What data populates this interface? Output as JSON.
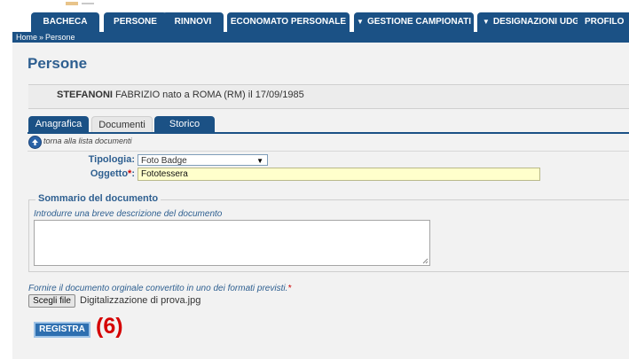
{
  "nav": {
    "tabs": [
      {
        "label": "BACHECA",
        "has_dropdown": false
      },
      {
        "label": "PERSONE",
        "has_dropdown": false
      },
      {
        "label": "RINNOVI",
        "has_dropdown": false
      },
      {
        "label": "ECONOMATO PERSONALE",
        "has_dropdown": false
      },
      {
        "label": "GESTIONE CAMPIONATI",
        "has_dropdown": true
      },
      {
        "label": "DESIGNAZIONI UDG",
        "has_dropdown": true
      },
      {
        "label": "PROFILO",
        "has_dropdown": false
      }
    ],
    "dropdown_glyph": "▼"
  },
  "breadcrumb": {
    "home": "Home",
    "separator": "»",
    "current": "Persone"
  },
  "page": {
    "title": "Persone"
  },
  "person": {
    "surname_name": "STEFANONI",
    "first_name_and_rest": " FABRIZIO nato a ROMA (RM) il 17/09/1985"
  },
  "subtabs": [
    {
      "label": "Anagrafica",
      "active": false
    },
    {
      "label": "Documenti",
      "active": true
    },
    {
      "label": "Storico",
      "active": false
    }
  ],
  "back_link": {
    "text": "torna alla lista documenti",
    "icon": "arrow-up-circle-icon"
  },
  "form": {
    "tipologia_label": "Tipologia:",
    "tipologia_value": "Foto Badge",
    "oggetto_label": "Oggetto",
    "oggetto_required_mark": "*",
    "oggetto_colon": ":",
    "oggetto_value": "Fototessera",
    "summary_legend": "Sommario del documento",
    "summary_hint": "Introdurre una breve descrizione del documento",
    "summary_value": "",
    "file_hint": "Fornire il documento orginale convertito in uno dei formati previsti.",
    "file_required_mark": "*",
    "file_button_label": "Scegli file",
    "file_name": "Digitalizzazione di prova.jpg",
    "submit_label": "REGISTRA"
  },
  "annotation": {
    "step_label": "(6)",
    "color": "#d50000"
  },
  "colors": {
    "nav_bg": "#1b5185",
    "title_blue": "#2e5f90",
    "highlight_input": "#ffffcc",
    "button_blue": "#2e6fb0"
  }
}
